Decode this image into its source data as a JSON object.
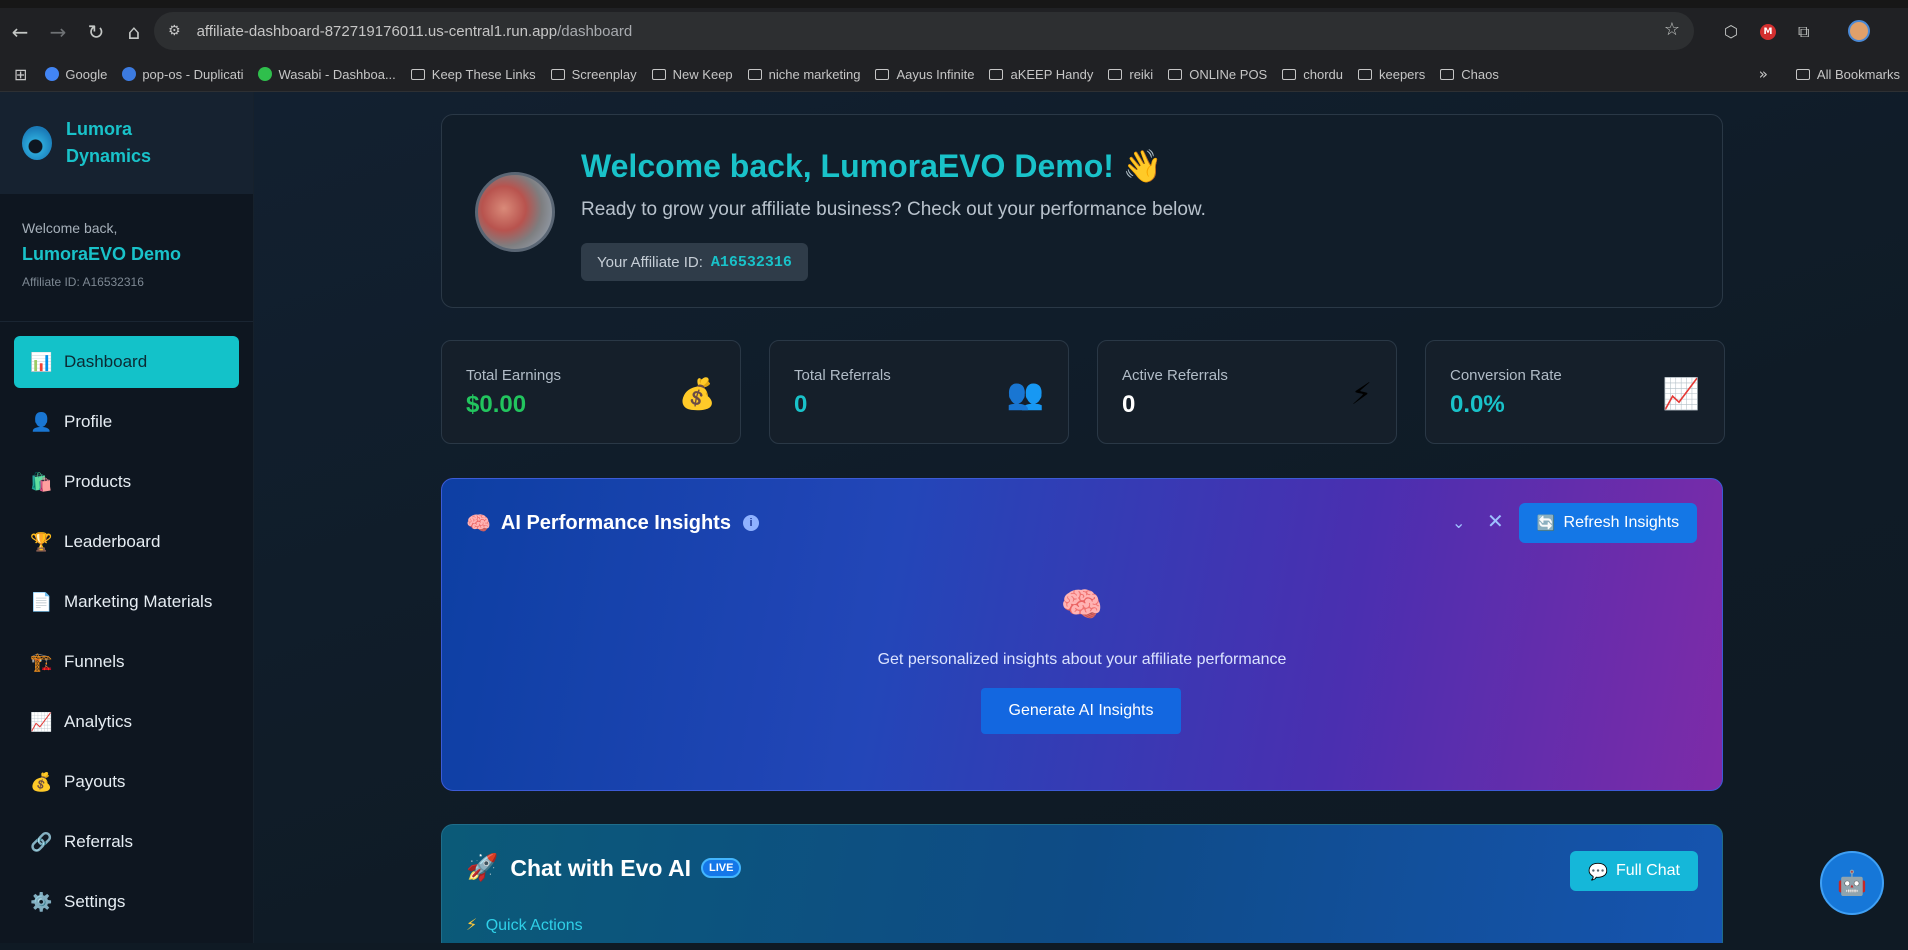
{
  "browser": {
    "url_host": "affiliate-dashboard-872719176011.us-central1.run.app",
    "url_path": "/dashboard",
    "bookmarks": [
      {
        "label": "Google",
        "type": "fav",
        "color": "#4285f4"
      },
      {
        "label": "pop-os - Duplicati",
        "type": "fav",
        "color": "#3c7be0"
      },
      {
        "label": "Wasabi - Dashboa...",
        "type": "fav",
        "color": "#2fbf4c"
      },
      {
        "label": "Keep These Links",
        "type": "folder"
      },
      {
        "label": "Screenplay",
        "type": "folder"
      },
      {
        "label": "New Keep",
        "type": "folder"
      },
      {
        "label": "niche marketing",
        "type": "folder"
      },
      {
        "label": "Aayus Infinite",
        "type": "folder"
      },
      {
        "label": "aKEEP Handy",
        "type": "folder"
      },
      {
        "label": "reiki",
        "type": "folder"
      },
      {
        "label": "ONLINe POS",
        "type": "folder"
      },
      {
        "label": "chordu",
        "type": "folder"
      },
      {
        "label": "keepers",
        "type": "folder"
      },
      {
        "label": "Chaos",
        "type": "folder"
      }
    ],
    "all_bookmarks": "All Bookmarks",
    "ext_badge": "M"
  },
  "sidebar": {
    "brand": "Lumora Dynamics",
    "welcome": "Welcome back,",
    "user_name": "LumoraEVO Demo",
    "affiliate_id": "Affiliate ID: A16532316",
    "items": [
      {
        "label": "Dashboard",
        "icon": "📊",
        "active": true
      },
      {
        "label": "Profile",
        "icon": "👤"
      },
      {
        "label": "Products",
        "icon": "🛍️"
      },
      {
        "label": "Leaderboard",
        "icon": "🏆"
      },
      {
        "label": "Marketing Materials",
        "icon": "📄"
      },
      {
        "label": "Funnels",
        "icon": "🏗️"
      },
      {
        "label": "Analytics",
        "icon": "📈"
      },
      {
        "label": "Payouts",
        "icon": "💰"
      },
      {
        "label": "Referrals",
        "icon": "🔗"
      },
      {
        "label": "Settings",
        "icon": "⚙️"
      }
    ]
  },
  "welcome": {
    "title": "Welcome back, LumoraEVO Demo! 👋",
    "subtitle": "Ready to grow your affiliate business? Check out your performance below.",
    "affiliate_label": "Your Affiliate ID:",
    "affiliate_value": "A16532316"
  },
  "stats": [
    {
      "label": "Total Earnings",
      "value": "$0.00",
      "icon": "💰",
      "color": "#22c55e"
    },
    {
      "label": "Total Referrals",
      "value": "0",
      "icon": "👥",
      "color": "#19c2c9"
    },
    {
      "label": "Active Referrals",
      "value": "0",
      "icon": "⚡",
      "color": "#ffffff"
    },
    {
      "label": "Conversion Rate",
      "value": "0.0%",
      "icon": "📈",
      "color": "#19c2c9"
    }
  ],
  "ai_insights": {
    "title_icon": "🧠",
    "title": "AI Performance Insights",
    "refresh_icon": "🔄",
    "refresh_label": "Refresh Insights",
    "center_icon": "🧠",
    "description": "Get personalized insights about your affiliate performance",
    "generate_label": "Generate AI Insights"
  },
  "chat": {
    "title_icon": "🚀",
    "title": "Chat with Evo AI",
    "live_badge": "LIVE",
    "full_chat_icon": "💬",
    "full_chat_label": "Full Chat",
    "quick_actions_icon": "⚡",
    "quick_actions_label": "Quick Actions"
  },
  "fab": {
    "icon": "🤖"
  }
}
